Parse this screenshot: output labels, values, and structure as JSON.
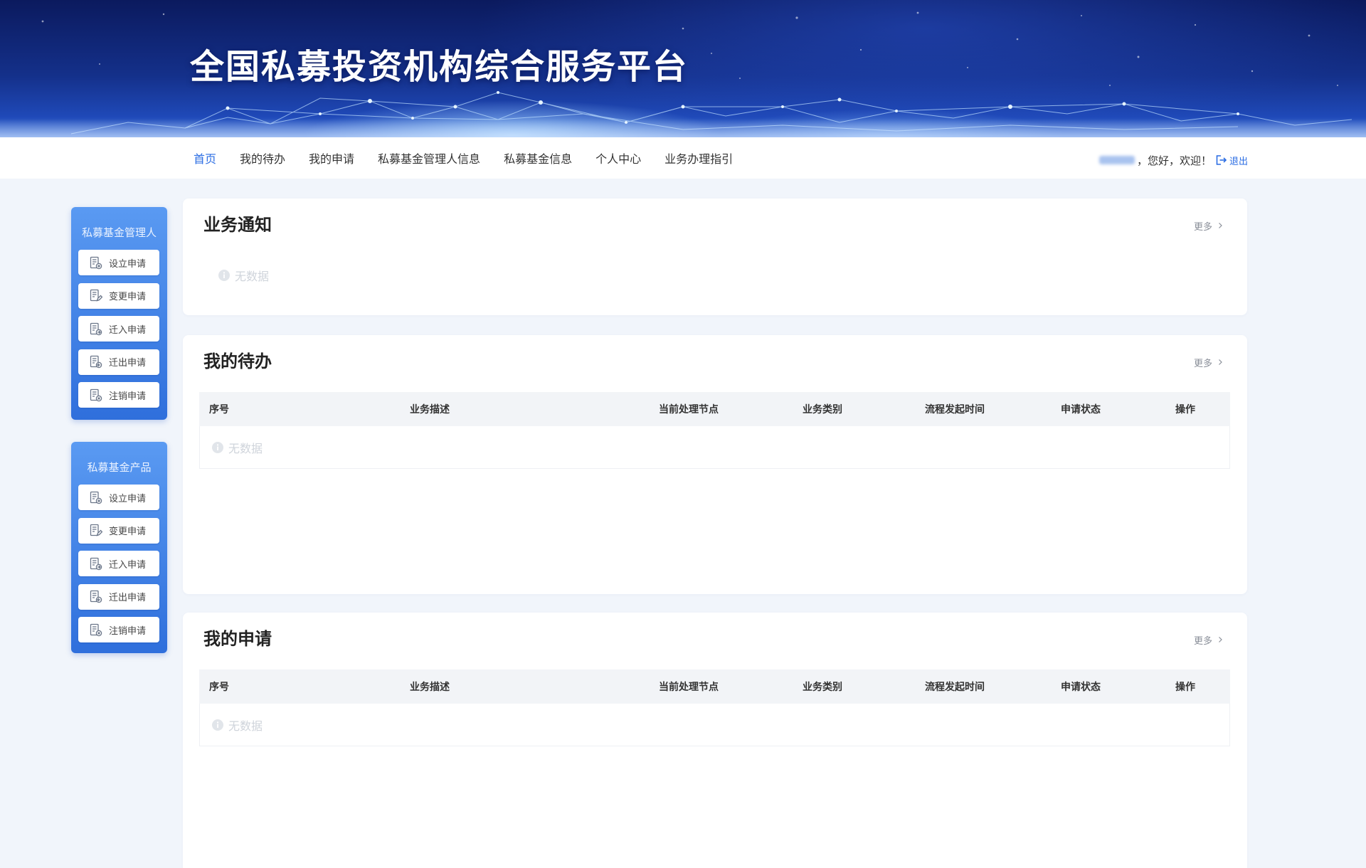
{
  "header": {
    "title": "全国私募投资机构综合服务平台"
  },
  "nav": {
    "items": [
      {
        "label": "首页",
        "active": true
      },
      {
        "label": "我的待办"
      },
      {
        "label": "我的申请"
      },
      {
        "label": "私募基金管理人信息"
      },
      {
        "label": "私募基金信息"
      },
      {
        "label": "个人中心"
      },
      {
        "label": "业务办理指引"
      }
    ]
  },
  "user": {
    "greeting": "，您好，欢迎！",
    "logout_label": "退出"
  },
  "sidebar": {
    "groups": [
      {
        "title": "私募基金管理人",
        "items": [
          "设立申请",
          "变更申请",
          "迁入申请",
          "迁出申请",
          "注销申请"
        ]
      },
      {
        "title": "私募基金产品",
        "items": [
          "设立申请",
          "变更申请",
          "迁入申请",
          "迁出申请",
          "注销申请"
        ]
      }
    ]
  },
  "panels": {
    "notice": {
      "title": "业务通知",
      "more_label": "更多",
      "empty_label": "无数据"
    },
    "todo": {
      "title": "我的待办",
      "more_label": "更多",
      "columns": [
        "序号",
        "业务描述",
        "当前处理节点",
        "业务类别",
        "流程发起时间",
        "申请状态",
        "操作"
      ],
      "rows": [],
      "empty_label": "无数据"
    },
    "apply": {
      "title": "我的申请",
      "more_label": "更多",
      "columns": [
        "序号",
        "业务描述",
        "当前处理节点",
        "业务类别",
        "流程发起时间",
        "申请状态",
        "操作"
      ],
      "rows": [],
      "empty_label": "无数据"
    }
  },
  "icons": {
    "sidebar": [
      "doc-add-icon",
      "doc-edit-icon",
      "doc-import-icon",
      "doc-export-icon",
      "doc-cancel-icon"
    ],
    "more": "chevron-right-icon",
    "empty": "info-icon",
    "logout": "logout-icon"
  },
  "colors": {
    "accent": "#2b6de3",
    "sidebar_top": "#5a9af2",
    "sidebar_bottom": "#2f6fdc",
    "page_bg": "#f1f5fb"
  }
}
